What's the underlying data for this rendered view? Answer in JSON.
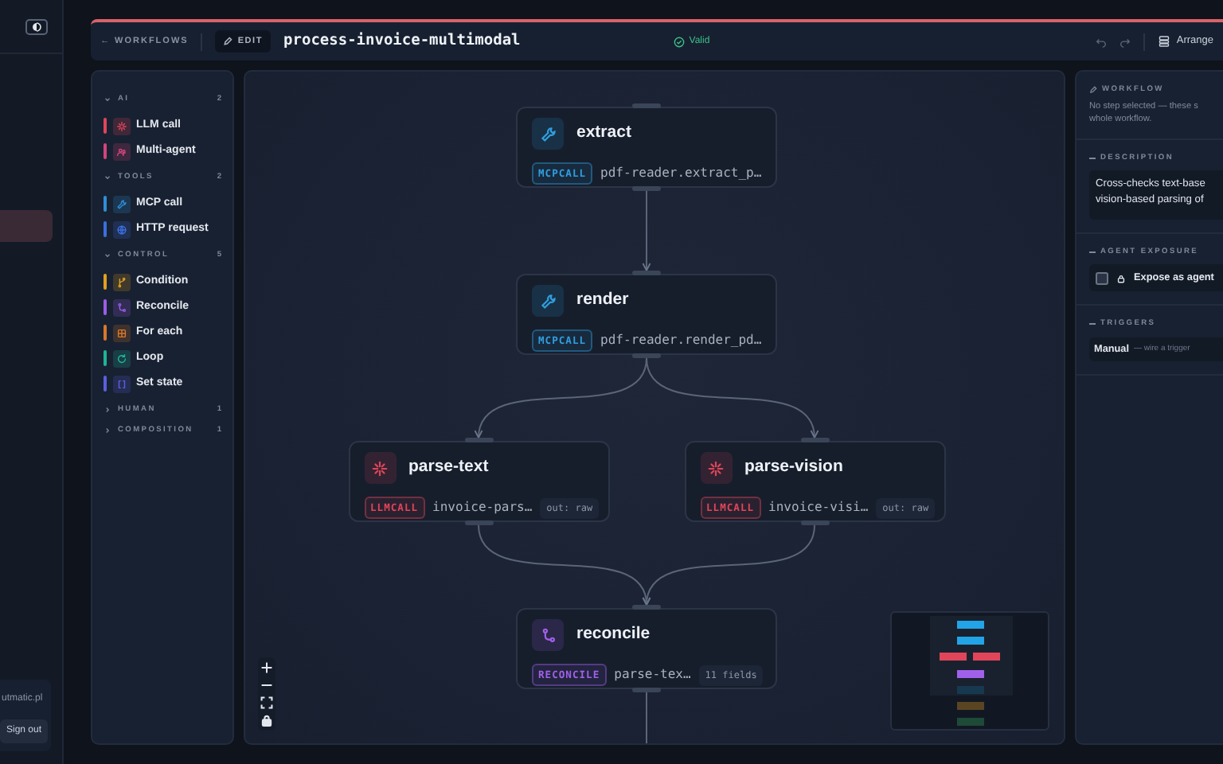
{
  "app_sidebar": {
    "user_email": "utmatic.pl",
    "sign_out": "Sign out"
  },
  "header": {
    "back": "← WORKFLOWS",
    "mode": "EDIT",
    "title": "process-invoice-multimodal",
    "validation": "Valid",
    "arrange": "Arrange"
  },
  "palette": {
    "sections": [
      {
        "title": "AI",
        "count": "2",
        "expanded": true,
        "items": [
          {
            "label": "LLM call",
            "kind": "llm",
            "color": "#e0455a"
          },
          {
            "label": "Multi-agent",
            "kind": "agents",
            "color": "#d2457a"
          }
        ]
      },
      {
        "title": "TOOLS",
        "count": "2",
        "expanded": true,
        "items": [
          {
            "label": "MCP call",
            "kind": "mcp",
            "color": "#2f8fd8"
          },
          {
            "label": "HTTP request",
            "kind": "http",
            "color": "#3b6fe0"
          }
        ]
      },
      {
        "title": "CONTROL",
        "count": "5",
        "expanded": true,
        "items": [
          {
            "label": "Condition",
            "kind": "condition",
            "color": "#e0a020"
          },
          {
            "label": "Reconcile",
            "kind": "reconcile",
            "color": "#9b5de5"
          },
          {
            "label": "For each",
            "kind": "foreach",
            "color": "#d9782a"
          },
          {
            "label": "Loop",
            "kind": "loop",
            "color": "#1fb39a"
          },
          {
            "label": "Set state",
            "kind": "state",
            "color": "#5a5fe0"
          }
        ]
      },
      {
        "title": "HUMAN",
        "count": "1",
        "expanded": false
      },
      {
        "title": "COMPOSITION",
        "count": "1",
        "expanded": false
      }
    ]
  },
  "canvas": {
    "nodes": [
      {
        "title": "extract",
        "kind": "mcp",
        "tag": "MCPCALL",
        "detail": "pdf-reader.extract_p…",
        "color": "#2f9fe0"
      },
      {
        "title": "render",
        "kind": "mcp",
        "tag": "MCPCALL",
        "detail": "pdf-reader.render_pd…",
        "color": "#2f9fe0"
      },
      {
        "title": "parse-text",
        "kind": "llm",
        "tag": "LLMCALL",
        "detail": "invoice-pars…",
        "chip": "out: raw",
        "color": "#e0455a"
      },
      {
        "title": "parse-vision",
        "kind": "llm",
        "tag": "LLMCALL",
        "detail": "invoice-visi…",
        "chip": "out: raw",
        "color": "#e0455a"
      },
      {
        "title": "reconcile",
        "kind": "reconcile",
        "tag": "RECONCILE",
        "detail": "parse-tex…",
        "chip": "11 fields",
        "color": "#a160ea"
      }
    ]
  },
  "inspector": {
    "heading": "WORKFLOW",
    "note": "No step selected — these s\nwhole workflow.",
    "description": {
      "heading": "DESCRIPTION",
      "value": "Cross-checks text-base\nvision-based parsing of"
    },
    "agent_exposure": {
      "heading": "AGENT EXPOSURE",
      "label": "Expose as agent",
      "checked": false
    },
    "triggers": {
      "heading": "TRIGGERS",
      "value": "Manual",
      "hint": "— wire a trigger"
    }
  }
}
